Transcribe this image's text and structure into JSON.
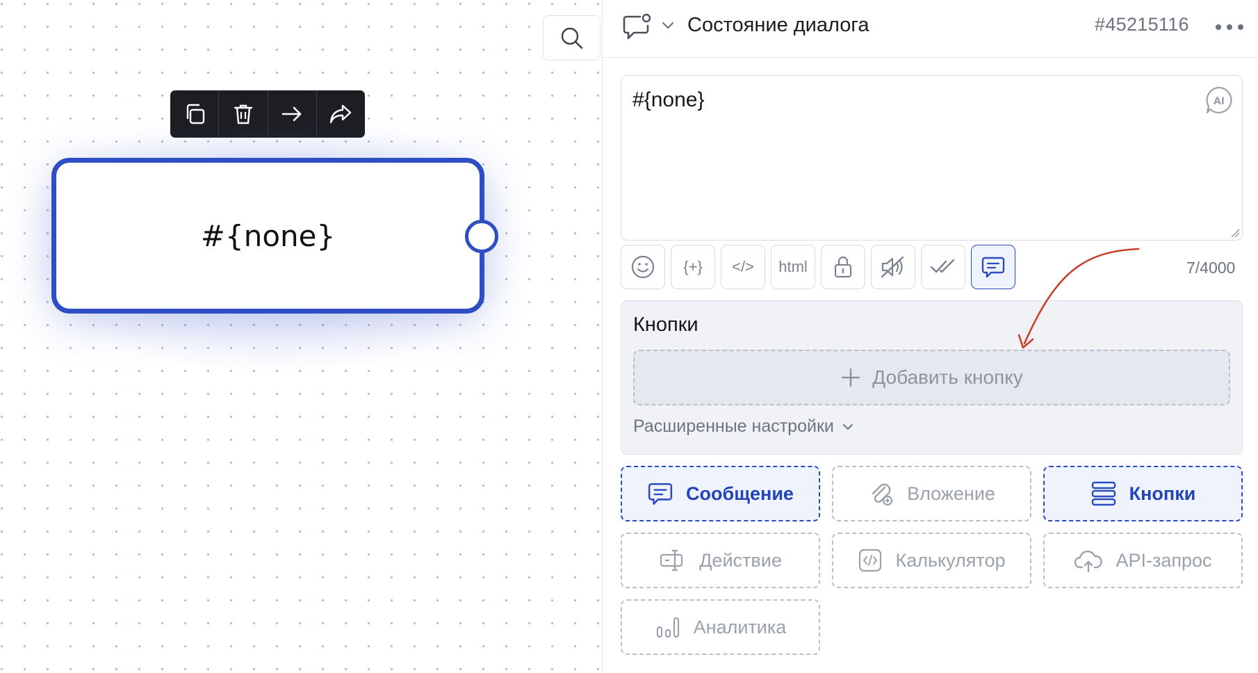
{
  "canvas": {
    "node_text": "#{none}",
    "toolbar": [
      "copy-icon",
      "trash-icon",
      "arrow-right-icon",
      "share-icon"
    ]
  },
  "header": {
    "title": "Состояние диалога",
    "id": "#45215116"
  },
  "editor": {
    "text": "#{none}",
    "char_count": "7/4000",
    "format_buttons": [
      {
        "icon": "emoji-icon"
      },
      {
        "icon": "variable-icon",
        "label": "{+}"
      },
      {
        "icon": "code-icon",
        "label": "</>"
      },
      {
        "icon": "html-icon",
        "label": "html"
      },
      {
        "icon": "lock-icon"
      },
      {
        "icon": "no-sound-icon"
      },
      {
        "icon": "double-check-icon"
      },
      {
        "icon": "message-icon",
        "active": true
      }
    ]
  },
  "buttons_section": {
    "title": "Кнопки",
    "add_label": "Добавить кнопку",
    "advanced_label": "Расширенные настройки"
  },
  "blocks": {
    "message": "Сообщение",
    "attachment": "Вложение",
    "buttons": "Кнопки",
    "action": "Действие",
    "calculator": "Калькулятор",
    "api": "API-запрос",
    "analytics": "Аналитика"
  },
  "colors": {
    "accent": "#2e4fc3",
    "annotation": "#c8402a"
  }
}
